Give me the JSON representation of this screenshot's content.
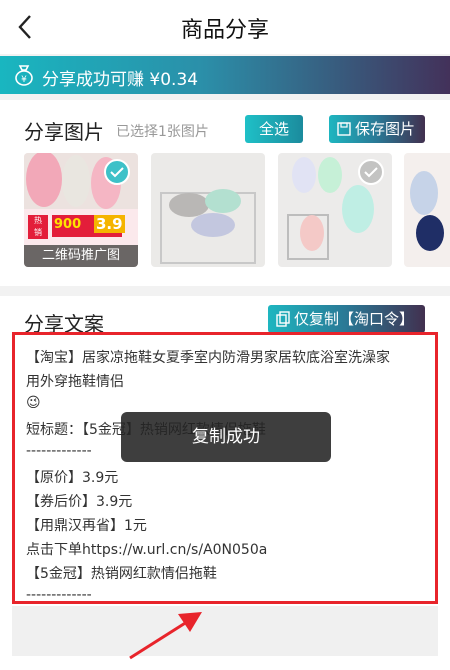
{
  "header": {
    "title": "商品分享"
  },
  "banner": {
    "text": "分享成功可赚 ¥0.34"
  },
  "share_images": {
    "title": "分享图片",
    "selected_text": "已选择1张图片",
    "select_all_label": "全选",
    "save_label": "保存图片",
    "qr_label": "二维码推广图",
    "promo_text": "900",
    "promo_price": "3.9"
  },
  "share_text": {
    "title": "分享文案",
    "copy_label": "仅复制【淘口令】",
    "lines": [
      "【淘宝】居家凉拖鞋女夏季室内防滑男家居软底浴室洗澡家",
      "用外穿拖鞋情侣",
      "😉",
      "短标题：【5金冠】热销网红款情侣拖鞋",
      "-------------",
      "【原价】3.9元",
      "【券后价】3.9元",
      "【用鼎汉再省】1元",
      "点击下单https://w.url.cn/s/A0N050a",
      "【5金冠】热销网红款情侣拖鞋",
      "-------------"
    ]
  },
  "toast": {
    "text": "复制成功"
  },
  "colors": {
    "accent": "#1fb8c2",
    "highlight_border": "#e8242b",
    "check_selected": "#3ec1c8"
  }
}
